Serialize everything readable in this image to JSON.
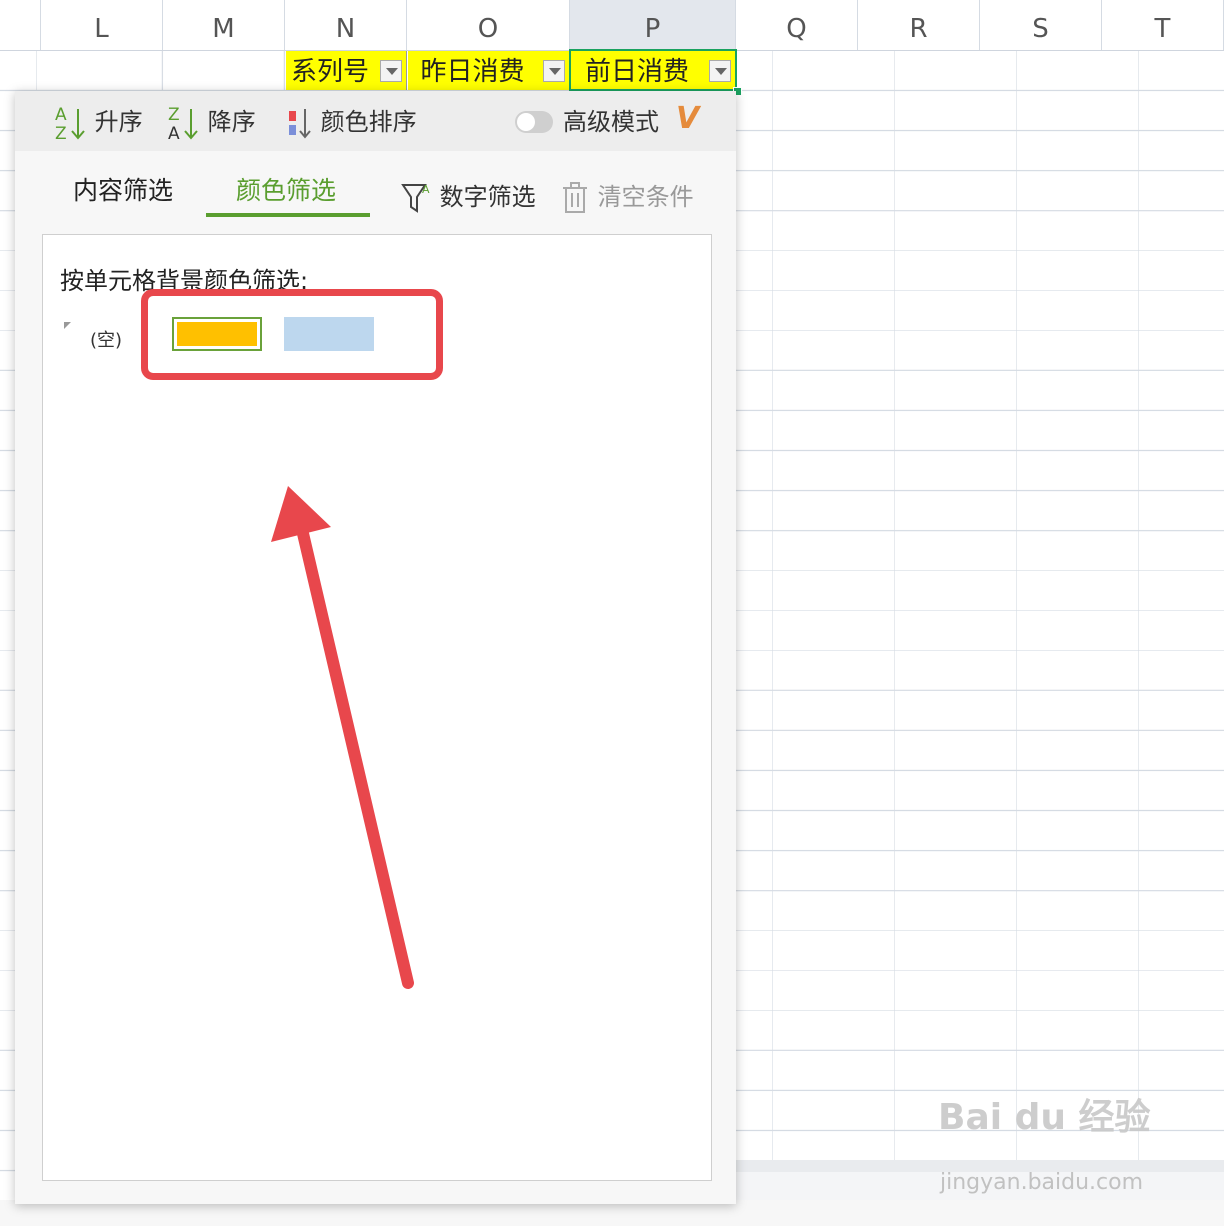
{
  "columns": [
    "L",
    "M",
    "N",
    "O",
    "P",
    "Q",
    "R",
    "S",
    "T"
  ],
  "header_cells": [
    {
      "text": "系列号"
    },
    {
      "text": "昨日消费"
    },
    {
      "text": "前日消费"
    }
  ],
  "toolbar": {
    "ascending": "升序",
    "descending": "降序",
    "color_sort": "颜色排序",
    "advanced_mode": "高级模式",
    "vip_badge": "V"
  },
  "tabs": {
    "content_filter": "内容筛选",
    "color_filter": "颜色筛选"
  },
  "actions": {
    "number_filter": "数字筛选",
    "clear_conditions": "清空条件"
  },
  "color_filter": {
    "label": "按单元格背景颜色筛选:",
    "empty_option": "(空)",
    "swatches": [
      {
        "color": "#ffc000",
        "selected": true
      },
      {
        "color": "#bdd7ee",
        "selected": false
      }
    ]
  },
  "colors": {
    "accent": "#5a9e2f",
    "header_fill": "#ffff00",
    "annotation": "#e8474c"
  },
  "watermark": {
    "brand": "Bai du 经验",
    "url": "jingyan.baidu.com"
  }
}
